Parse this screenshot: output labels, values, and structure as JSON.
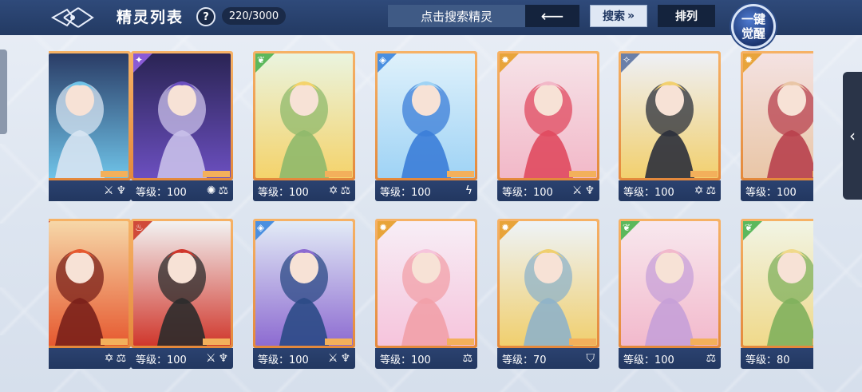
{
  "header": {
    "title": "精灵列表",
    "help_label": "?",
    "count": "220/3000",
    "search_placeholder": "点击搜索精灵",
    "back_label": "⟵",
    "filter_label": "搜索",
    "sort_label": "排列",
    "awaken_line1": "一键",
    "awaken_line2": "觉醒"
  },
  "right_tab": {
    "label": "‹"
  },
  "cards": [
    {
      "level_text": "00",
      "element": "none",
      "element_color": "#6a7fa8",
      "traits": [
        "⚔",
        "♆"
      ],
      "art_colors": [
        "#2a3c66",
        "#6fc3e8",
        "#d7e4f2"
      ]
    },
    {
      "level_text": "等级：100",
      "element": "star",
      "element_color": "#8a5bd6",
      "traits": [
        "✺",
        "⚖"
      ],
      "art_colors": [
        "#2a2454",
        "#6b4fbf",
        "#c9c0ea"
      ]
    },
    {
      "level_text": "等级：100",
      "element": "leaf",
      "element_color": "#5cb85c",
      "traits": [
        "✡",
        "⚖"
      ],
      "art_colors": [
        "#eaf4df",
        "#f4d36b",
        "#8fb96c"
      ]
    },
    {
      "level_text": "等级：100",
      "element": "water",
      "element_color": "#4a8fe0",
      "traits": [
        "ϟ"
      ],
      "art_colors": [
        "#dff1fb",
        "#9fd3f5",
        "#3b7dd8"
      ]
    },
    {
      "level_text": "等级：100",
      "element": "light",
      "element_color": "#e8a43a",
      "traits": [
        "⚔",
        "♆"
      ],
      "art_colors": [
        "#f6e3e8",
        "#f2b8c8",
        "#e04a5f"
      ]
    },
    {
      "level_text": "等级：100",
      "element": "none",
      "element_color": "#6a7fa8",
      "traits": [
        "✡",
        "⚖"
      ],
      "art_colors": [
        "#eef0f6",
        "#f2d06e",
        "#2b2f3b"
      ]
    },
    {
      "level_text": "等级：100",
      "element": "light",
      "element_color": "#e8a43a",
      "traits": [
        "✡"
      ],
      "art_colors": [
        "#f4e2e2",
        "#e9c6a6",
        "#b8404d"
      ]
    },
    {
      "level_text": "00",
      "element": "fire",
      "element_color": "#d04a3a",
      "traits": [
        "✡",
        "⚖"
      ],
      "art_colors": [
        "#f6d7a8",
        "#e6592f",
        "#7a2019"
      ]
    },
    {
      "level_text": "等级：100",
      "element": "fire",
      "element_color": "#d04a3a",
      "traits": [
        "⚔",
        "♆"
      ],
      "art_colors": [
        "#f2f2f2",
        "#d0372c",
        "#2b2b2b"
      ]
    },
    {
      "level_text": "等级：100",
      "element": "water",
      "element_color": "#4a8fe0",
      "traits": [
        "⚔",
        "♆"
      ],
      "art_colors": [
        "#e2ebf6",
        "#8d6bd1",
        "#2b4a86"
      ]
    },
    {
      "level_text": "等级：100",
      "element": "light",
      "element_color": "#e8a43a",
      "traits": [
        "⚖"
      ],
      "art_colors": [
        "#f7eef6",
        "#f6c4dc",
        "#f2a0a8"
      ]
    },
    {
      "level_text": "等级：70",
      "element": "light",
      "element_color": "#e8a43a",
      "traits": [
        "⛉"
      ],
      "art_colors": [
        "#eef3f7",
        "#f0cf6e",
        "#8fb3c9"
      ]
    },
    {
      "level_text": "等级：100",
      "element": "leaf",
      "element_color": "#5cb85c",
      "traits": [
        "⚖"
      ],
      "art_colors": [
        "#f8e8ee",
        "#f2b9cc",
        "#c7a0d8"
      ]
    },
    {
      "level_text": "等级：80",
      "element": "leaf",
      "element_color": "#5cb85c",
      "traits": [
        "✡"
      ],
      "art_colors": [
        "#f1f4e4",
        "#f0d98a",
        "#7fb05c"
      ]
    }
  ]
}
